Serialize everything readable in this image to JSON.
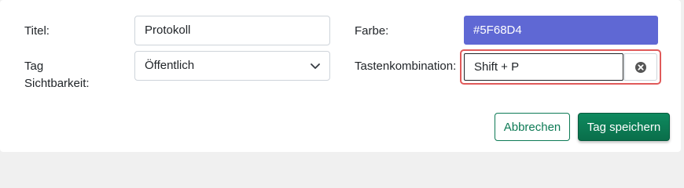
{
  "form": {
    "title_label": "Titel:",
    "title_value": "Protokoll",
    "color_label": "Farbe:",
    "color_value": "#5F68D4",
    "visibility_label_line1": "Tag",
    "visibility_label_line2": "Sichtbarkeit:",
    "visibility_value": "Öffentlich",
    "hotkey_label": "Tastenkombination:",
    "hotkey_value": "Shift + P"
  },
  "buttons": {
    "cancel_label": "Abbrechen",
    "save_label": "Tag speichern"
  },
  "colors": {
    "tag_color": "#5F68D4",
    "focus_ring": "#e05a5a",
    "primary": "#0a6e4a"
  },
  "icons": {
    "select_chevron": "chevron-down-icon",
    "clear_hotkey": "close-circle-icon"
  }
}
